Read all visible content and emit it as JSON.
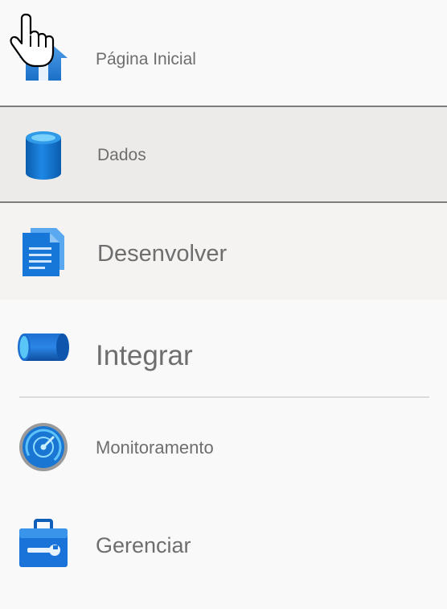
{
  "nav": {
    "items": [
      {
        "id": "home",
        "label": "Página Inicial",
        "icon": "home-icon"
      },
      {
        "id": "data",
        "label": "Dados",
        "icon": "database-icon",
        "selected": true
      },
      {
        "id": "develop",
        "label": "Desenvolver",
        "icon": "document-icon"
      },
      {
        "id": "integrate",
        "label": "Integrar",
        "icon": "pipeline-icon"
      },
      {
        "id": "monitor",
        "label": "Monitoramento",
        "icon": "gauge-icon"
      },
      {
        "id": "manage",
        "label": "Gerenciar",
        "icon": "toolbox-icon"
      }
    ]
  },
  "colors": {
    "accent": "#0f6cbd",
    "accent_light": "#3a9be8",
    "label_text": "#6e6e6e",
    "selected_bg": "#edebea",
    "selected_border": "#7d7d7d"
  },
  "cursor": {
    "icon": "hand-pointer-cursor-icon"
  }
}
